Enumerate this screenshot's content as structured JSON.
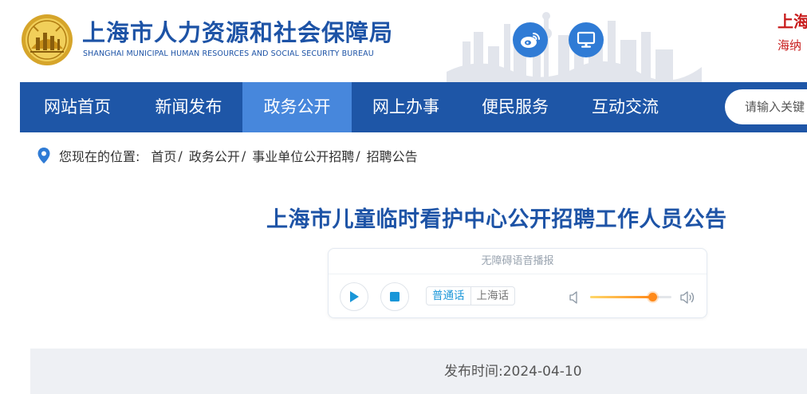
{
  "header": {
    "title": "上海市人力资源和社会保障局",
    "subtitle": "SHANGHAI MUNICIPAL HUMAN RESOURCES AND SOCIAL SECURITY BUREAU",
    "logo_icon": "bureau-emblem-icon",
    "buttons": [
      {
        "name": "weibo-button",
        "icon": "weibo-icon"
      },
      {
        "name": "desktop-button",
        "icon": "desktop-icon"
      }
    ],
    "promo_line1": "上海",
    "promo_line2": "海纳",
    "colors": {
      "brand": "#1d53a6",
      "button": "#2f7bd5",
      "promo": "#c81c1c"
    }
  },
  "nav": {
    "items": [
      {
        "label": "网站首页",
        "active": false
      },
      {
        "label": "新闻发布",
        "active": false
      },
      {
        "label": "政务公开",
        "active": true
      },
      {
        "label": "网上办事",
        "active": false
      },
      {
        "label": "便民服务",
        "active": false
      },
      {
        "label": "互动交流",
        "active": false
      }
    ],
    "search_placeholder": "请输入关键",
    "colors": {
      "bar": "#1e56a7",
      "active": "#4787dc"
    }
  },
  "breadcrumb": {
    "prefix": "您现在的位置:",
    "items": [
      "首页",
      "政务公开",
      "事业单位公开招聘",
      "招聘公告"
    ],
    "separator": "/",
    "icon": "location-pin-icon"
  },
  "article": {
    "title": "上海市儿童临时看护中心公开招聘工作人员公告",
    "publish_label": "发布时间:",
    "publish_date": "2024-04-10"
  },
  "player": {
    "caption": "无障碍语音播报",
    "play_icon": "play-icon",
    "stop_icon": "stop-icon",
    "dialects": [
      "普通话",
      "上海话"
    ],
    "selected_dialect": "普通话",
    "volume_low_icon": "volume-low-icon",
    "volume_high_icon": "volume-high-icon",
    "volume_level": 0.76,
    "colors": {
      "accent": "#1996d8",
      "volume": "#ff8a1a"
    }
  }
}
